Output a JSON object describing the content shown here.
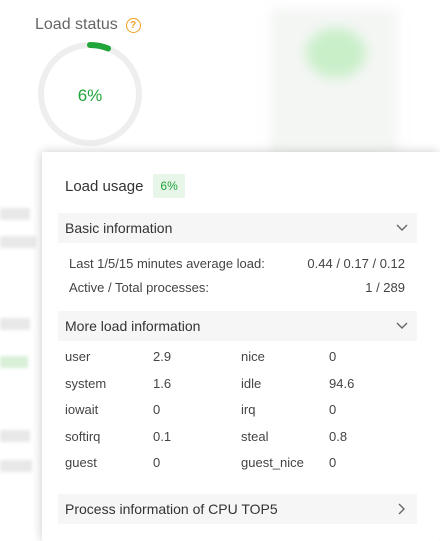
{
  "load_status": {
    "title": "Load status",
    "help_icon": "question-circle-icon",
    "percent_text": "6%",
    "percent_value": 6,
    "accent": "#20a53a"
  },
  "popover": {
    "title": "Load usage",
    "badge": "6%",
    "basic_section": {
      "label": "Basic information",
      "rows": [
        {
          "key": "Last 1/5/15 minutes average load:",
          "value": "0.44 / 0.17 / 0.12"
        },
        {
          "key": "Active / Total processes:",
          "value": "1 / 289"
        }
      ]
    },
    "more_section": {
      "label": "More load information",
      "rows": [
        [
          "user",
          "2.9",
          "nice",
          "0"
        ],
        [
          "system",
          "1.6",
          "idle",
          "94.6"
        ],
        [
          "iowait",
          "0",
          "irq",
          "0"
        ],
        [
          "softirq",
          "0.1",
          "steal",
          "0.8"
        ],
        [
          "guest",
          "0",
          "guest_nice",
          "0"
        ]
      ]
    },
    "process_section": {
      "label": "Process information of CPU TOP5"
    }
  }
}
